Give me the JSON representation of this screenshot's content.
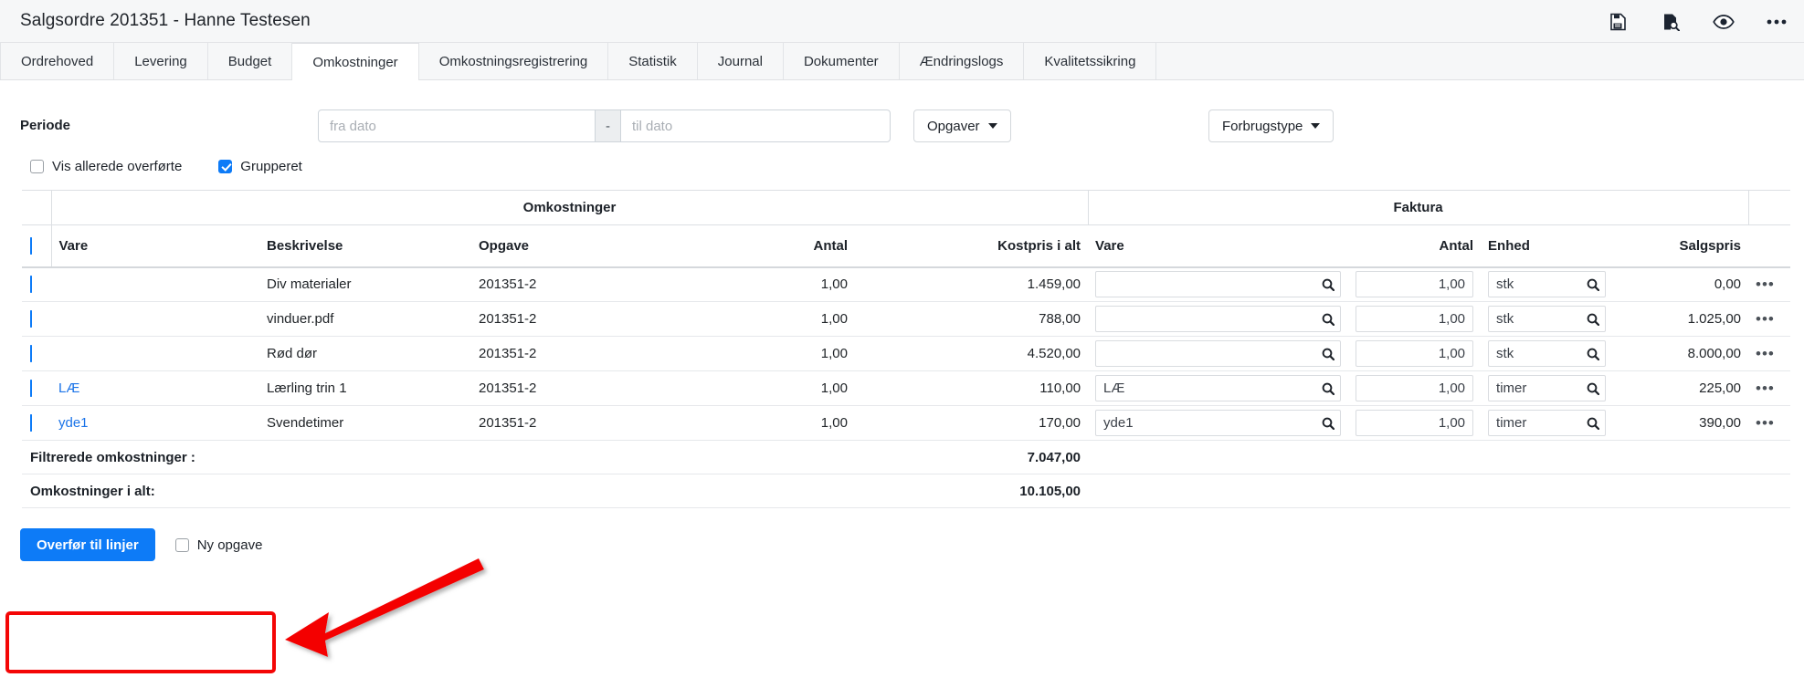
{
  "window": {
    "title": "Salgsordre 201351 - Hanne Testesen",
    "icons": [
      {
        "name": "save-document-icon",
        "label": "Gem"
      },
      {
        "name": "document-search-icon",
        "label": "Vis"
      },
      {
        "name": "eye-icon",
        "label": "Forhåndsvisning"
      },
      {
        "name": "ellipsis-icon",
        "label": "Mere"
      }
    ]
  },
  "tabs": [
    {
      "label": "Ordrehoved",
      "active": false
    },
    {
      "label": "Levering",
      "active": false
    },
    {
      "label": "Budget",
      "active": false
    },
    {
      "label": "Omkostninger",
      "active": true
    },
    {
      "label": "Omkostningsregistrering",
      "active": false
    },
    {
      "label": "Statistik",
      "active": false
    },
    {
      "label": "Journal",
      "active": false
    },
    {
      "label": "Dokumenter",
      "active": false
    },
    {
      "label": "Ændringslogs",
      "active": false
    },
    {
      "label": "Kvalitetssikring",
      "active": false
    }
  ],
  "filters": {
    "period_label": "Periode",
    "date_from_value": "",
    "date_from_placeholder": "fra dato",
    "date_separator": "-",
    "date_to_value": "",
    "date_to_placeholder": "til dato",
    "opgaver_button": "Opgaver",
    "forbrugstype_button": "Forbrugstype",
    "checkboxes": [
      {
        "label": "Vis allerede overførte",
        "checked": false
      },
      {
        "label": "Grupperet",
        "checked": true
      }
    ]
  },
  "table": {
    "group_headers": {
      "omkostninger": "Omkostninger",
      "faktura": "Faktura"
    },
    "select_all_checked": true,
    "columns_cost": [
      "Vare",
      "Beskrivelse",
      "Opgave",
      "Antal",
      "Kostpris i alt"
    ],
    "columns_invoice": [
      "Vare",
      "Antal",
      "Enhed",
      "Salgspris"
    ],
    "rows": [
      {
        "checked": true,
        "vare": "",
        "beskrivelse": "Div materialer",
        "opgave": "201351-2",
        "antal": "1,00",
        "kostpris": "1.459,00",
        "f_vare": "",
        "f_antal": "1,00",
        "f_enhed": "stk",
        "f_salgspris": "0,00",
        "menu": "•••"
      },
      {
        "checked": true,
        "vare": "",
        "beskrivelse": "vinduer.pdf",
        "opgave": "201351-2",
        "antal": "1,00",
        "kostpris": "788,00",
        "f_vare": "",
        "f_antal": "1,00",
        "f_enhed": "stk",
        "f_salgspris": "1.025,00",
        "menu": "•••"
      },
      {
        "checked": true,
        "vare": "",
        "beskrivelse": "Rød dør",
        "opgave": "201351-2",
        "antal": "1,00",
        "kostpris": "4.520,00",
        "f_vare": "",
        "f_antal": "1,00",
        "f_enhed": "stk",
        "f_salgspris": "8.000,00",
        "menu": "•••"
      },
      {
        "checked": true,
        "vare": "LÆ",
        "beskrivelse": "Lærling trin 1",
        "opgave": "201351-2",
        "antal": "1,00",
        "kostpris": "110,00",
        "f_vare": "LÆ",
        "f_antal": "1,00",
        "f_enhed": "timer",
        "f_salgspris": "225,00",
        "menu": "•••"
      },
      {
        "checked": true,
        "vare": "yde1",
        "beskrivelse": "Svendetimer",
        "opgave": "201351-2",
        "antal": "1,00",
        "kostpris": "170,00",
        "f_vare": "yde1",
        "f_antal": "1,00",
        "f_enhed": "timer",
        "f_salgspris": "390,00",
        "menu": "•••"
      }
    ],
    "summary": [
      {
        "label": "Filtrerede omkostninger :",
        "value": "7.047,00"
      },
      {
        "label": "Omkostninger i alt:",
        "value": "10.105,00"
      }
    ]
  },
  "footer": {
    "transfer_button": "Overfør til linjer",
    "new_task_label": "Ny opgave",
    "new_task_checked": false
  },
  "colors": {
    "accent": "#0d7bf7",
    "link": "#1a73e8",
    "annotation": "#f40606",
    "chrome": "#f6f7f8",
    "border": "#dcdfe3"
  }
}
